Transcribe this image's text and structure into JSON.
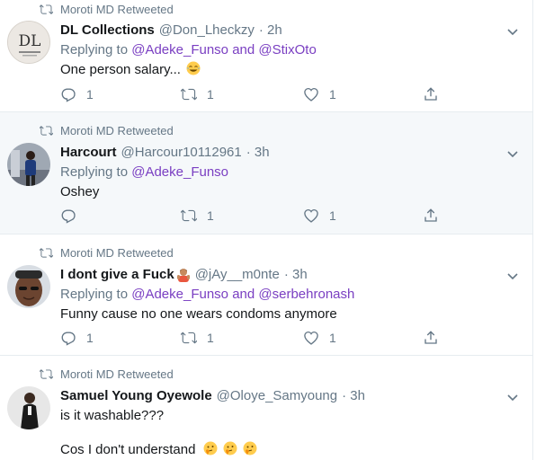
{
  "colors": {
    "link": "#7a3fc2",
    "muted": "#657786",
    "text": "#14171a",
    "highlight_bg": "#f5f8fa"
  },
  "tweets": [
    {
      "retweeted_by": "Moroti MD Retweeted",
      "name": "DL Collections",
      "name_emoji": "",
      "handle": "@Don_Lheckzy",
      "time": "· 2h",
      "replying_prefix": "Replying to",
      "mentions": [
        "@Adeke_Funso",
        "@StixOto"
      ],
      "mention_joiner": "and",
      "text": "One person salary...",
      "text_emoji": "joy-emoji",
      "reply_count": "1",
      "retweet_count": "1",
      "like_count": "1",
      "avatar_text": "DL"
    },
    {
      "retweeted_by": "Moroti MD Retweeted",
      "name": "Harcourt",
      "handle": "@Harcour10112961",
      "time": "· 3h",
      "replying_prefix": "Replying to",
      "mentions": [
        "@Adeke_Funso"
      ],
      "text": "Oshey",
      "reply_count": "",
      "retweet_count": "1",
      "like_count": "1"
    },
    {
      "retweeted_by": "Moroti MD Retweeted",
      "name": "I dont give a Fuck",
      "name_emoji": "person-gesturing-emoji",
      "handle": "@jAy__m0nte",
      "time": "· 3h",
      "replying_prefix": "Replying to",
      "mentions": [
        "@Adeke_Funso",
        "@serbehronash"
      ],
      "mention_joiner": "and",
      "text": "Funny cause no one wears condoms anymore",
      "reply_count": "1",
      "retweet_count": "1",
      "like_count": "1"
    },
    {
      "retweeted_by": "Moroti MD Retweeted",
      "name": "Samuel Young Oyewole",
      "handle": "@Oloye_Samyoung",
      "time": "· 3h",
      "text": "is it washable???",
      "text2": "Cos I don't understand",
      "text2_emoji": "thinking-face-emoji"
    }
  ]
}
